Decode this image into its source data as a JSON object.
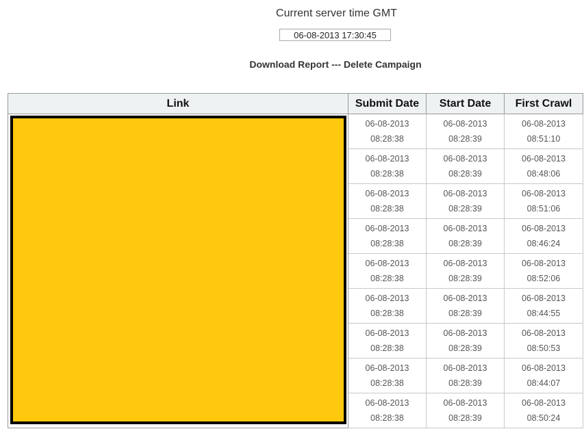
{
  "server_time": {
    "label": "Current server time GMT",
    "value": "06-08-2013 17:30:45"
  },
  "actions": {
    "download_label": "Download Report",
    "separator": "---",
    "delete_label": "Delete Campaign"
  },
  "table": {
    "headers": {
      "link": "Link",
      "submit_date": "Submit Date",
      "start_date": "Start Date",
      "first_crawl": "First Crawl"
    },
    "link_column_redacted_color": "#fec80d",
    "rows": [
      {
        "submit_date": "06-08-2013",
        "submit_time": "08:28:38",
        "start_date": "06-08-2013",
        "start_time": "08:28:39",
        "first_crawl_date": "06-08-2013",
        "first_crawl_time": "08:51:10"
      },
      {
        "submit_date": "06-08-2013",
        "submit_time": "08:28:38",
        "start_date": "06-08-2013",
        "start_time": "08:28:39",
        "first_crawl_date": "06-08-2013",
        "first_crawl_time": "08:48:06"
      },
      {
        "submit_date": "06-08-2013",
        "submit_time": "08:28:38",
        "start_date": "06-08-2013",
        "start_time": "08:28:39",
        "first_crawl_date": "06-08-2013",
        "first_crawl_time": "08:51:06"
      },
      {
        "submit_date": "06-08-2013",
        "submit_time": "08:28:38",
        "start_date": "06-08-2013",
        "start_time": "08:28:39",
        "first_crawl_date": "06-08-2013",
        "first_crawl_time": "08:46:24"
      },
      {
        "submit_date": "06-08-2013",
        "submit_time": "08:28:38",
        "start_date": "06-08-2013",
        "start_time": "08:28:39",
        "first_crawl_date": "06-08-2013",
        "first_crawl_time": "08:52:06"
      },
      {
        "submit_date": "06-08-2013",
        "submit_time": "08:28:38",
        "start_date": "06-08-2013",
        "start_time": "08:28:39",
        "first_crawl_date": "06-08-2013",
        "first_crawl_time": "08:44:55"
      },
      {
        "submit_date": "06-08-2013",
        "submit_time": "08:28:38",
        "start_date": "06-08-2013",
        "start_time": "08:28:39",
        "first_crawl_date": "06-08-2013",
        "first_crawl_time": "08:50:53"
      },
      {
        "submit_date": "06-08-2013",
        "submit_time": "08:28:38",
        "start_date": "06-08-2013",
        "start_time": "08:28:39",
        "first_crawl_date": "06-08-2013",
        "first_crawl_time": "08:44:07"
      },
      {
        "submit_date": "06-08-2013",
        "submit_time": "08:28:38",
        "start_date": "06-08-2013",
        "start_time": "08:28:39",
        "first_crawl_date": "06-08-2013",
        "first_crawl_time": "08:50:24"
      }
    ]
  }
}
